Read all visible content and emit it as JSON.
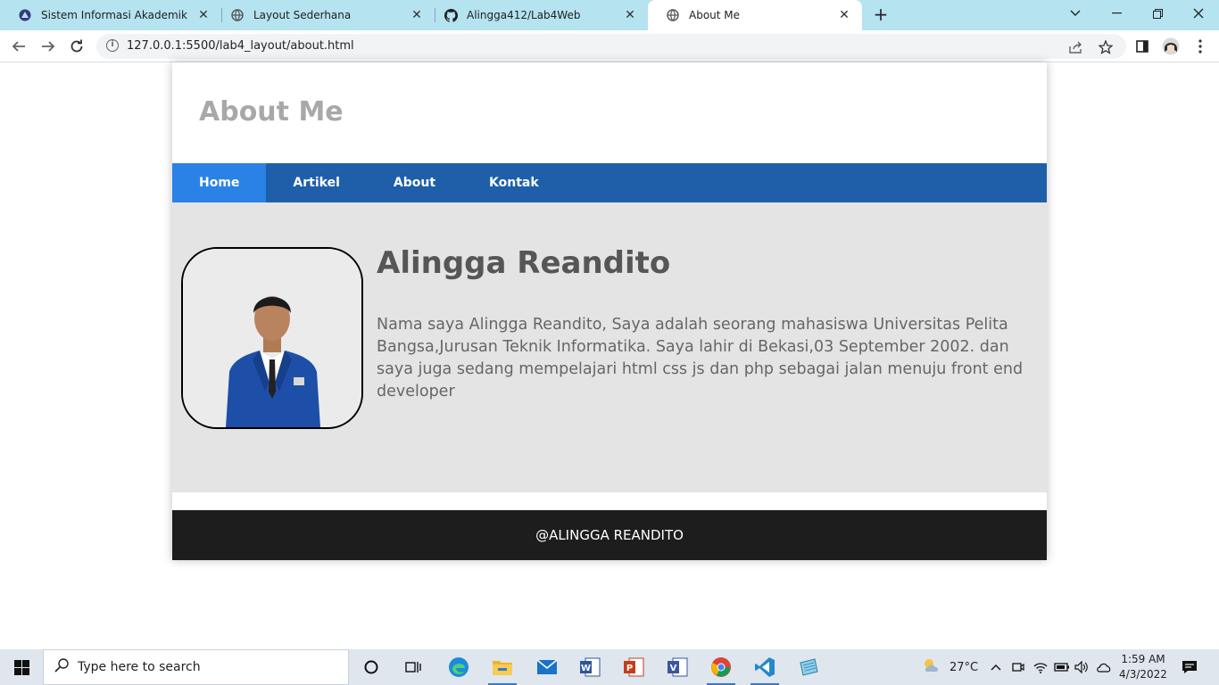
{
  "browser": {
    "tabs": [
      {
        "title": "Sistem Informasi Akademik",
        "icon": "university-icon",
        "active": false
      },
      {
        "title": "Layout Sederhana",
        "icon": "globe-icon",
        "active": false
      },
      {
        "title": "Alingga412/Lab4Web",
        "icon": "github-icon",
        "active": false
      },
      {
        "title": "About Me",
        "icon": "globe-icon",
        "active": true
      }
    ],
    "close_glyph": "✕",
    "new_tab_glyph": "+",
    "url": "127.0.0.1:5500/lab4_layout/about.html"
  },
  "site": {
    "header_title": "About Me",
    "nav": [
      {
        "label": "Home",
        "active": true
      },
      {
        "label": "Artikel",
        "active": false
      },
      {
        "label": "About",
        "active": false
      },
      {
        "label": "Kontak",
        "active": false
      }
    ],
    "profile": {
      "name": "Alingga Reandito",
      "bio": "Nama saya Alingga Reandito, Saya adalah seorang mahasiswa Universitas Pelita Bangsa,Jurusan Teknik Informatika. Saya lahir di Bekasi,03 September 2002. dan saya juga sedang mempelajari html css js dan php sebagai jalan menuju front end developer"
    },
    "footer": "@ALINGGA REANDITO"
  },
  "colors": {
    "nav_bg": "#1f5fa9",
    "nav_active": "#2b82e6",
    "content_bg": "#e4e4e4",
    "footer_bg": "#1d1d1d",
    "tabbar_bg": "#b5e3f0"
  },
  "taskbar": {
    "search_placeholder": "Type here to search",
    "weather": "27°C",
    "time": "1:59 AM",
    "date": "4/3/2022"
  }
}
